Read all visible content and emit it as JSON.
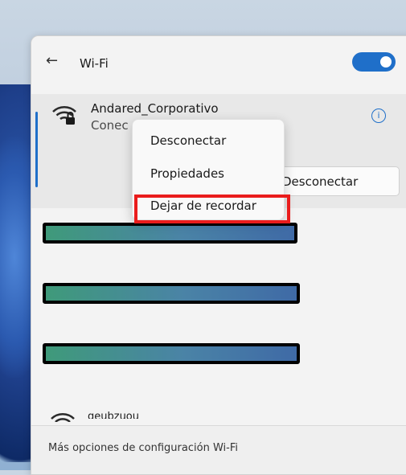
{
  "header": {
    "back_icon": "back-arrow-icon",
    "title": "Wi-Fi",
    "toggle_on": true,
    "toggle_color": "#1f6fc9"
  },
  "connected_network": {
    "name": "Andared_Corporativo",
    "status": "Conec",
    "icon": "wifi-secured-icon",
    "info_icon": "info-icon",
    "disconnect_button": "Desconectar"
  },
  "context_menu": {
    "items": [
      "Desconectar",
      "Propiedades",
      "Dejar de recordar"
    ],
    "highlighted_item": "Dejar de recordar",
    "highlight_color": "#ea1c1c"
  },
  "other_networks": {
    "last_name": "geubzuou"
  },
  "footer": {
    "link": "Más opciones de configuración Wi-Fi"
  }
}
